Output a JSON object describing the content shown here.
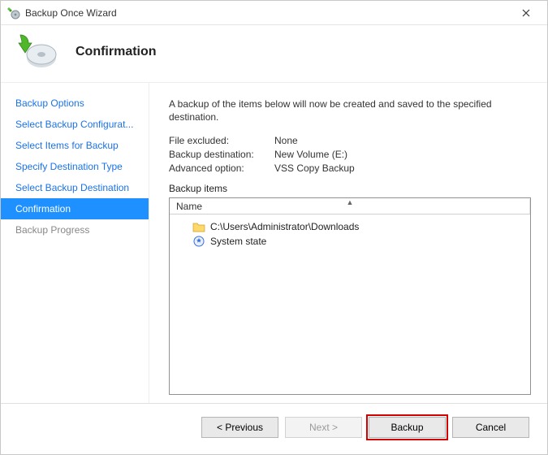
{
  "window": {
    "title": "Backup Once Wizard"
  },
  "header": {
    "heading": "Confirmation"
  },
  "sidebar": {
    "items": [
      {
        "label": "Backup Options",
        "state": "link"
      },
      {
        "label": "Select Backup Configurat...",
        "state": "link"
      },
      {
        "label": "Select Items for Backup",
        "state": "link"
      },
      {
        "label": "Specify Destination Type",
        "state": "link"
      },
      {
        "label": "Select Backup Destination",
        "state": "link"
      },
      {
        "label": "Confirmation",
        "state": "selected"
      },
      {
        "label": "Backup Progress",
        "state": "inactive"
      }
    ]
  },
  "content": {
    "description": "A backup of the items below will now be created and saved to the specified destination.",
    "fields": {
      "file_excluded_label": "File excluded:",
      "file_excluded_value": "None",
      "backup_destination_label": "Backup destination:",
      "backup_destination_value": "New Volume (E:)",
      "advanced_option_label": "Advanced option:",
      "advanced_option_value": "VSS Copy Backup"
    },
    "backup_items_label": "Backup items",
    "list": {
      "column": "Name",
      "items": [
        {
          "icon": "folder-icon",
          "label": "C:\\Users\\Administrator\\Downloads"
        },
        {
          "icon": "system-state-icon",
          "label": "System state"
        }
      ]
    }
  },
  "footer": {
    "previous": "< Previous",
    "next": "Next >",
    "backup": "Backup",
    "cancel": "Cancel"
  }
}
